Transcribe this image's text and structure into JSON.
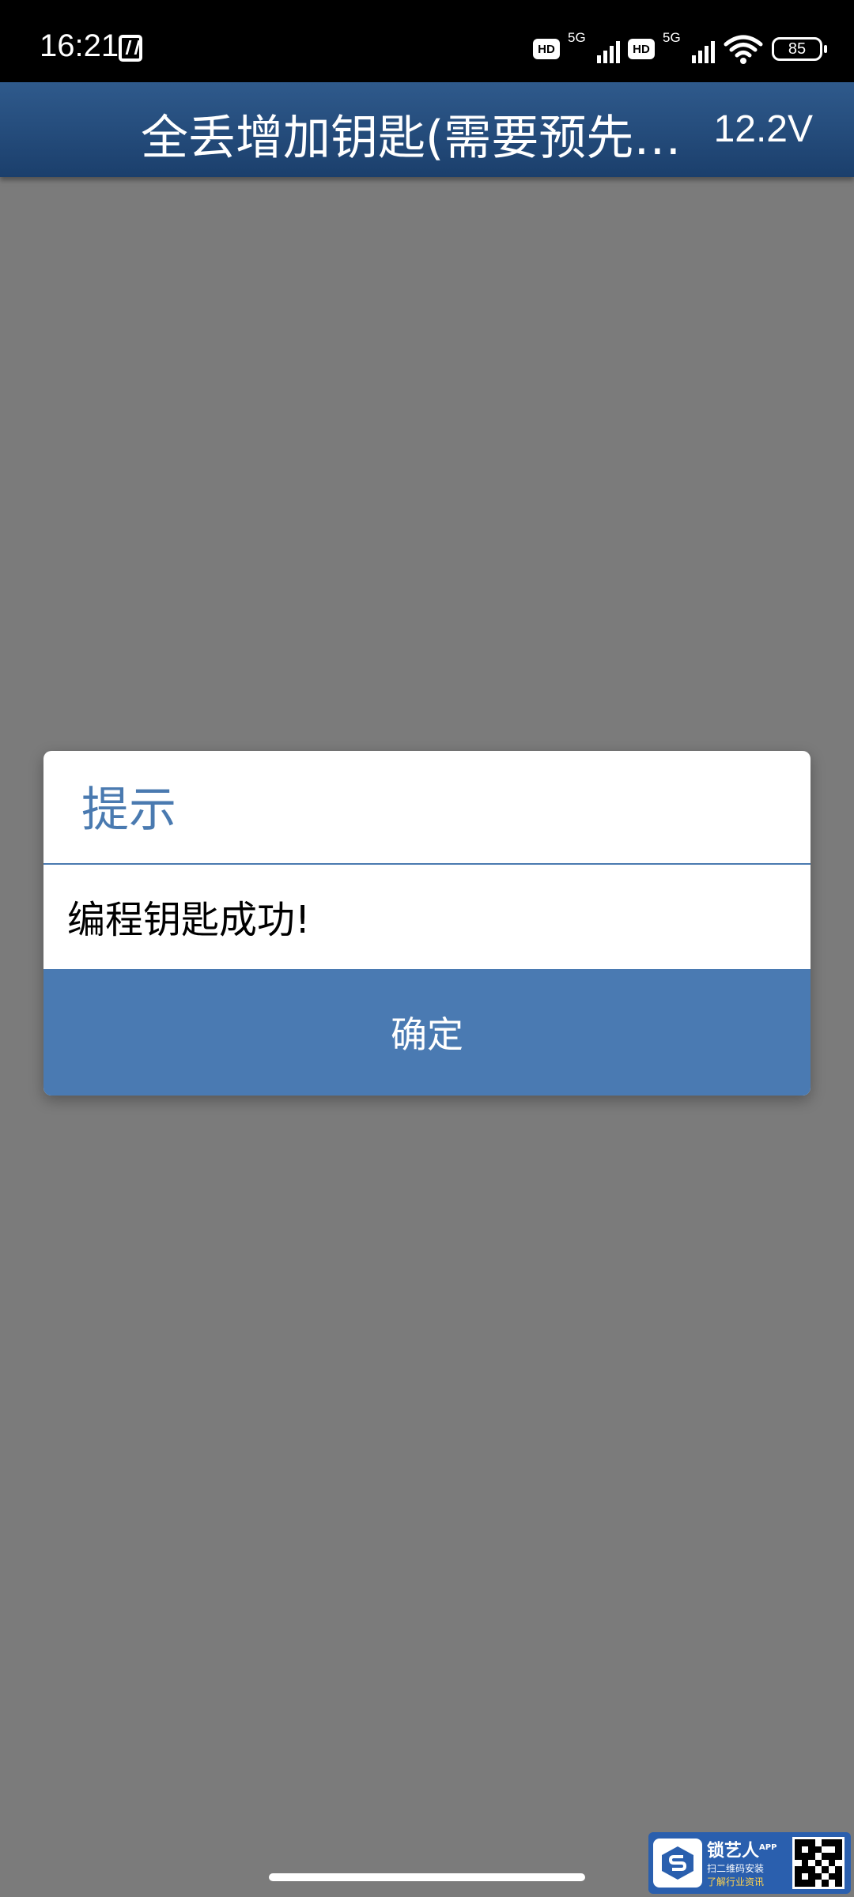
{
  "status_bar": {
    "time": "16:21",
    "network": "5G",
    "hd": "HD",
    "battery": "85",
    "icons": [
      "nfc-icon",
      "hd-icon",
      "signal-icon",
      "wifi-icon",
      "battery-icon"
    ]
  },
  "header": {
    "title": "全丢增加钥匙(需要预先…",
    "voltage": "12.2V",
    "color": "#1f4576"
  },
  "dialog": {
    "title": "提示",
    "message": "编程钥匙成功!",
    "confirm_label": "确定",
    "accent_color": "#4a7ab2"
  },
  "ad_banner": {
    "name": "锁艺人",
    "badge": "APP",
    "line1": "扫二维码安装",
    "line2": "了解行业资讯"
  }
}
